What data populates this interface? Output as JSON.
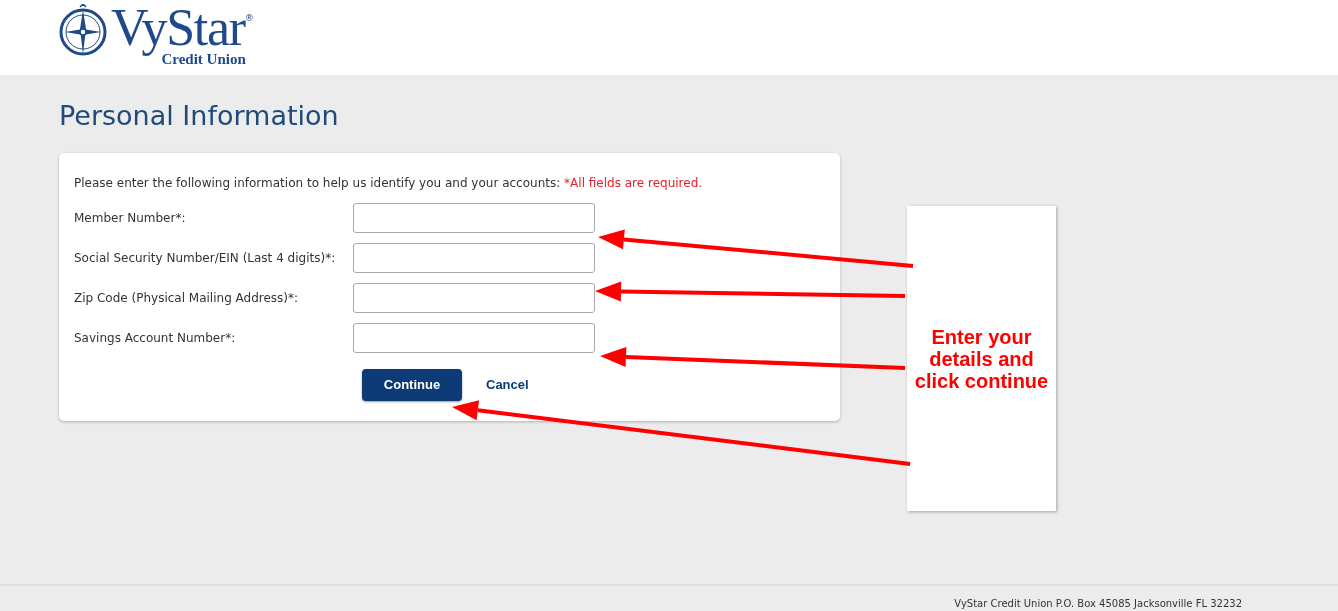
{
  "header": {
    "logo": {
      "name": "VyStar",
      "mark": "®",
      "subtitle": "Credit Union"
    }
  },
  "page_title": "Personal Information",
  "form": {
    "intro": "Please enter the following information to help us identify you and your accounts:",
    "required_note": "*All fields are required.",
    "fields": [
      {
        "label": "Member Number*:"
      },
      {
        "label": "Social Security Number/EIN (Last 4 digits)*:"
      },
      {
        "label": "Zip Code (Physical Mailing Address)*:"
      },
      {
        "label": "Savings Account Number*:"
      }
    ],
    "buttons": [
      {
        "label": "Continue",
        "kind": "primary"
      },
      {
        "label": "Cancel",
        "kind": "link"
      }
    ]
  },
  "annotation": {
    "text": "Enter your details and click continue"
  },
  "footer": {
    "address": "VyStar Credit Union P.O. Box 45085 Jacksonville FL 32232"
  }
}
